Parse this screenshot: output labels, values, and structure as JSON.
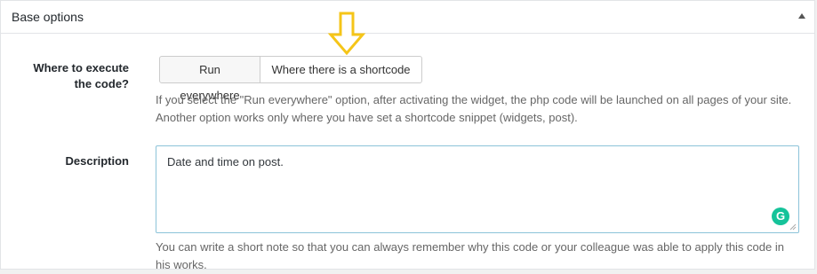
{
  "panel": {
    "title": "Base options",
    "toggle_icon": "triangle-up-icon"
  },
  "execute": {
    "label": "Where to execute the code?",
    "options": [
      "Run everywhere",
      "Where there is a shortcode"
    ],
    "selected": "Where there is a shortcode",
    "help": "If you select the \"Run everywhere\" option, after activating the widget, the php code will be launched on all pages of your site. Another option works only where you have set a shortcode snippet (widgets, post)."
  },
  "description": {
    "label": "Description",
    "value": "Date and time on post.",
    "help": "You can write a short note so that you can always remember why this code or your colleague was able to apply this code in his works."
  },
  "colors": {
    "arrow": "#f5c518",
    "textarea_border": "#8cc3d9",
    "grammarly": "#15c39a"
  },
  "icons": {
    "annotation": "down-arrow-icon",
    "grammarly": "grammarly-icon",
    "resize": "resize-handle-icon"
  }
}
